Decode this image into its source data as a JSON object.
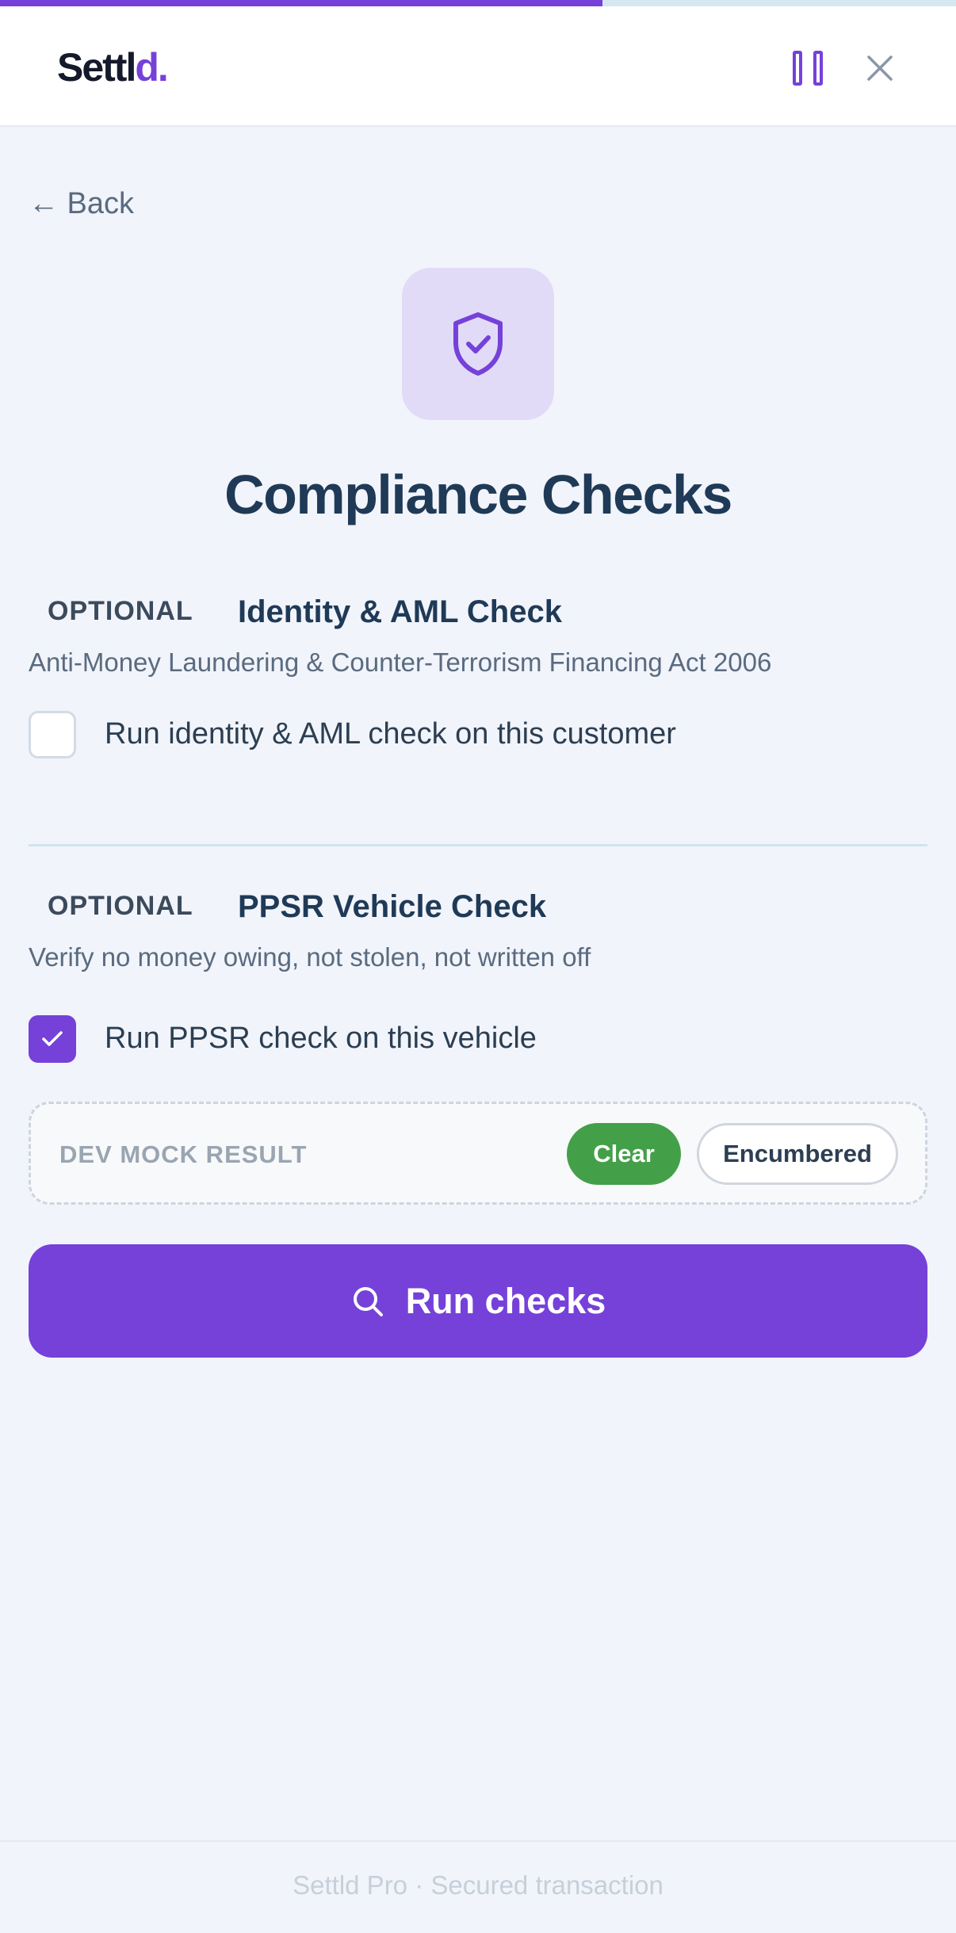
{
  "progress": {
    "fraction": 0.63
  },
  "brand": {
    "name_main": "Settl",
    "name_accent": "d.",
    "accent_color": "#7541d9"
  },
  "header": {
    "pause_icon": "pause-icon",
    "close_icon": "close-icon"
  },
  "nav": {
    "back_label": "← Back"
  },
  "page": {
    "title": "Compliance Checks",
    "hero_icon": "shield-check-icon"
  },
  "aml": {
    "tag": "OPTIONAL",
    "title": "Identity & AML Check",
    "description": "Anti-Money Laundering & Counter-Terrorism Financing Act 2006",
    "checkbox_label": "Run identity & AML check on this customer",
    "checked": false
  },
  "ppsr": {
    "tag": "OPTIONAL",
    "title": "PPSR Vehicle Check",
    "description": "Verify no money owing, not stolen, not written off",
    "checkbox_label": "Run PPSR check on this vehicle",
    "checked": true
  },
  "mock": {
    "label": "DEV MOCK RESULT",
    "options": [
      "Clear",
      "Encumbered"
    ],
    "selected": "Clear",
    "selected_color": "#43a048"
  },
  "action": {
    "run_label": "Run checks",
    "icon": "search-icon"
  },
  "footer": {
    "text": "Settld Pro · Secured transaction"
  }
}
